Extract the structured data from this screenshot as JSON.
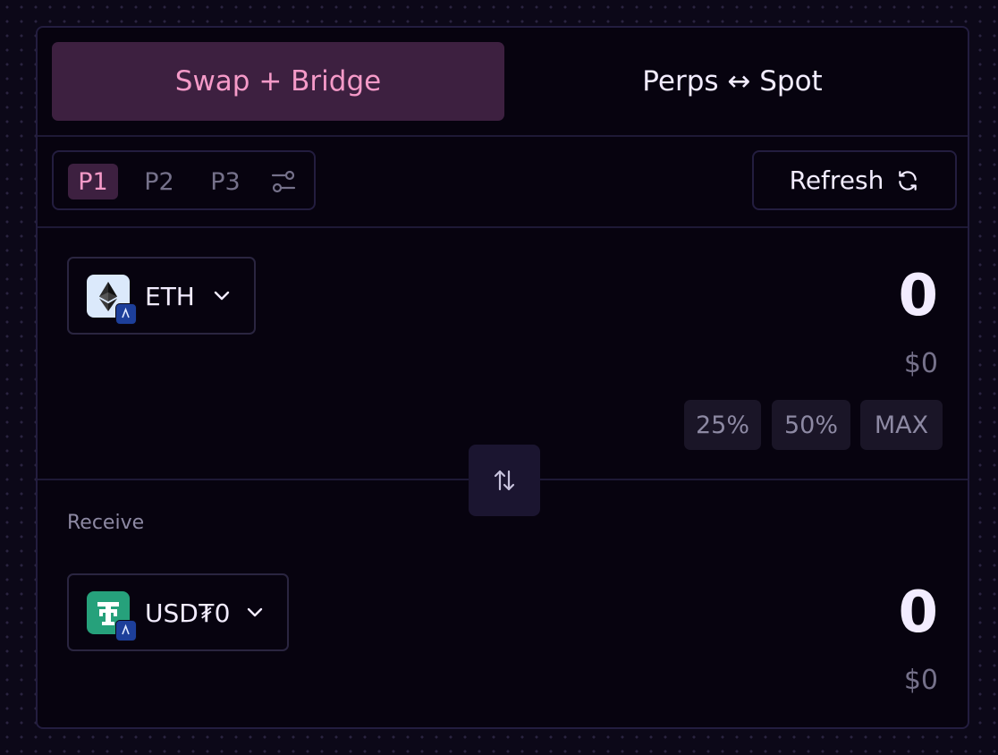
{
  "tabs": {
    "swap_bridge": "Swap + Bridge",
    "perps_spot": "Perps ↔ Spot"
  },
  "presets": {
    "items": [
      "P1",
      "P2",
      "P3"
    ],
    "active": "P1",
    "settings_icon": "sliders-icon"
  },
  "refresh": {
    "label": "Refresh",
    "icon": "refresh-icon"
  },
  "sell": {
    "token": "ETH",
    "token_icon": "ethereum-logo",
    "chain_badge": "arbitrum-badge",
    "amount": "0",
    "usd_value": "$0",
    "quick_amounts": [
      "25%",
      "50%",
      "MAX"
    ]
  },
  "flip_icon": "swap-arrows-icon",
  "receive": {
    "label": "Receive",
    "token": "USD₮0",
    "token_icon": "tether-logo",
    "chain_badge": "arbitrum-badge",
    "amount": "0",
    "usd_value": "$0"
  },
  "colors": {
    "background": "#0c0818",
    "panel": "#07030f",
    "border": "#231d3f",
    "accent_bg": "#3d2040",
    "accent_text": "#f59ac8",
    "primary_text": "#f2ecff",
    "muted_text": "#75718a",
    "tether_green": "#26a17b",
    "arbitrum_blue": "#1d3f9a"
  }
}
